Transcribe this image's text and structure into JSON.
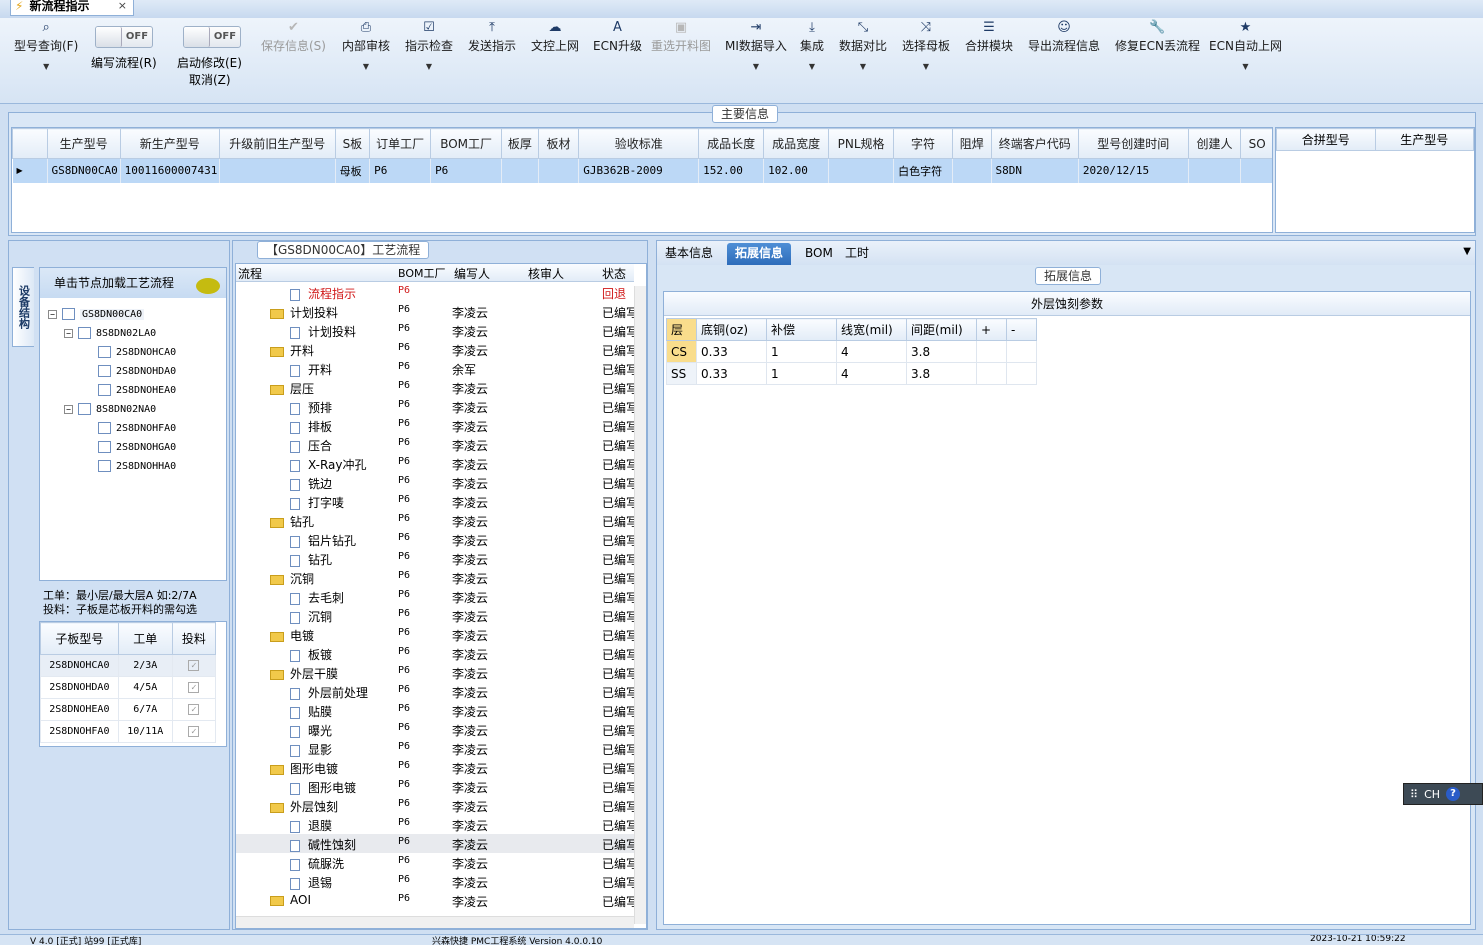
{
  "window_tab": {
    "title": "新流程指示",
    "close": "×"
  },
  "toolbar": {
    "items": [
      {
        "label": "型号查询(F)",
        "icon": "search-icon"
      },
      {
        "label": "保存信息(S)",
        "icon": "check-icon"
      },
      {
        "label": "内部审核",
        "icon": "printer-icon"
      },
      {
        "label": "指示检查",
        "icon": "checkbox-icon"
      },
      {
        "label": "发送指示",
        "icon": "upload-icon"
      },
      {
        "label": "文控上网",
        "icon": "cloud-upload-icon"
      },
      {
        "label": "ECN升级",
        "icon": "font-icon"
      },
      {
        "label": "重选开料图",
        "icon": "image-icon"
      },
      {
        "label": "MI数据导入",
        "icon": "sign-in-icon"
      },
      {
        "label": "集成",
        "icon": "download-icon"
      },
      {
        "label": "数据对比",
        "icon": "compress-icon"
      },
      {
        "label": "选择母板",
        "icon": "shuffle-icon"
      },
      {
        "label": "合拼模块",
        "icon": "list-icon"
      },
      {
        "label": "导出流程信息",
        "icon": "smile-icon"
      },
      {
        "label": "修复ECN丢流程",
        "icon": "wrench-icon"
      },
      {
        "label": "ECN自动上网",
        "icon": "star-icon"
      }
    ],
    "toggle_edit": {
      "state": "OFF",
      "label": "编写流程(R)"
    },
    "toggle_modify": {
      "state": "OFF",
      "label": "启动修改(E)",
      "sublabel": "取消(Z)"
    }
  },
  "main_info": {
    "caption": "主要信息",
    "columns": [
      "生产型号",
      "新生产型号",
      "升级前旧生产型号",
      "S板",
      "订单工厂",
      "BOM工厂",
      "板厚",
      "板材",
      "验收标准",
      "成品长度",
      "成品宽度",
      "PNL规格",
      "字符",
      "阻焊",
      "终端客户代码",
      "型号创建时间",
      "创建人",
      "SO"
    ],
    "row": [
      "GS8DN00CA0",
      "10011600007431",
      "",
      "母板",
      "P6",
      "P6",
      "",
      "",
      "GJB362B-2009",
      "152.00",
      "102.00",
      "",
      "白色字符",
      "",
      "S8DN",
      "2020/12/15",
      "",
      ""
    ],
    "merge_columns": [
      "合拼型号",
      "生产型号"
    ]
  },
  "left": {
    "vertical_tab": "设备结构",
    "hint": "单击节点加载工艺流程",
    "tree": [
      {
        "label": "GS8DN00CA0",
        "level": 0
      },
      {
        "label": "8S8DN02LA0",
        "level": 1
      },
      {
        "label": "2S8DNOHCA0",
        "level": 2
      },
      {
        "label": "2S8DNOHDA0",
        "level": 2
      },
      {
        "label": "2S8DNOHEA0",
        "level": 2
      },
      {
        "label": "8S8DN02NA0",
        "level": 1
      },
      {
        "label": "2S8DNOHFA0",
        "level": 2
      },
      {
        "label": "2S8DNOHGA0",
        "level": 2
      },
      {
        "label": "2S8DNOHHA0",
        "level": 2
      }
    ],
    "note_line1": "工单：最小层/最大层A 如:2/7A",
    "note_line2": "投料：子板是芯板开料的需勾选",
    "sub_columns": [
      "子板型号",
      "工单",
      "投料"
    ],
    "sub_rows": [
      [
        "2S8DNOHCA0",
        "2/3A"
      ],
      [
        "2S8DNOHDA0",
        "4/5A"
      ],
      [
        "2S8DNOHEA0",
        "6/7A"
      ],
      [
        "2S8DNOHFA0",
        "10/11A"
      ]
    ]
  },
  "flow": {
    "caption": "【GS8DN00CA0】工艺流程",
    "columns": [
      "流程",
      "BOM工厂",
      "编写人",
      "核审人",
      "状态"
    ],
    "rows": [
      {
        "name": "流程指示",
        "type": "doc",
        "bom": "P6",
        "author": "",
        "status": "回退",
        "red": true
      },
      {
        "name": "计划投料",
        "type": "folder",
        "bom": "P6",
        "author": "李凌云",
        "status": "已编写"
      },
      {
        "name": "计划投料",
        "type": "doc",
        "bom": "P6",
        "author": "李凌云",
        "status": "已编写"
      },
      {
        "name": "开料",
        "type": "folder",
        "bom": "P6",
        "author": "李凌云",
        "status": "已编写"
      },
      {
        "name": "开料",
        "type": "doc",
        "bom": "P6",
        "author": "余军",
        "status": "已编写"
      },
      {
        "name": "层压",
        "type": "folder",
        "bom": "P6",
        "author": "李凌云",
        "status": "已编写"
      },
      {
        "name": "预排",
        "type": "doc",
        "bom": "P6",
        "author": "李凌云",
        "status": "已编写"
      },
      {
        "name": "排板",
        "type": "doc",
        "bom": "P6",
        "author": "李凌云",
        "status": "已编写"
      },
      {
        "name": "压合",
        "type": "doc",
        "bom": "P6",
        "author": "李凌云",
        "status": "已编写"
      },
      {
        "name": "X-Ray冲孔",
        "type": "doc",
        "bom": "P6",
        "author": "李凌云",
        "status": "已编写"
      },
      {
        "name": "铣边",
        "type": "doc",
        "bom": "P6",
        "author": "李凌云",
        "status": "已编写"
      },
      {
        "name": "打字唛",
        "type": "doc",
        "bom": "P6",
        "author": "李凌云",
        "status": "已编写"
      },
      {
        "name": "钻孔",
        "type": "folder",
        "bom": "P6",
        "author": "李凌云",
        "status": "已编写"
      },
      {
        "name": "铝片钻孔",
        "type": "doc",
        "bom": "P6",
        "author": "李凌云",
        "status": "已编写"
      },
      {
        "name": "钻孔",
        "type": "doc",
        "bom": "P6",
        "author": "李凌云",
        "status": "已编写"
      },
      {
        "name": "沉铜",
        "type": "folder",
        "bom": "P6",
        "author": "李凌云",
        "status": "已编写"
      },
      {
        "name": "去毛刺",
        "type": "doc",
        "bom": "P6",
        "author": "李凌云",
        "status": "已编写"
      },
      {
        "name": "沉铜",
        "type": "doc",
        "bom": "P6",
        "author": "李凌云",
        "status": "已编写"
      },
      {
        "name": "电镀",
        "type": "folder",
        "bom": "P6",
        "author": "李凌云",
        "status": "已编写"
      },
      {
        "name": "板镀",
        "type": "doc",
        "bom": "P6",
        "author": "李凌云",
        "status": "已编写"
      },
      {
        "name": "外层干膜",
        "type": "folder",
        "bom": "P6",
        "author": "李凌云",
        "status": "已编写"
      },
      {
        "name": "外层前处理",
        "type": "doc",
        "bom": "P6",
        "author": "李凌云",
        "status": "已编写"
      },
      {
        "name": "贴膜",
        "type": "doc",
        "bom": "P6",
        "author": "李凌云",
        "status": "已编写"
      },
      {
        "name": "曝光",
        "type": "doc",
        "bom": "P6",
        "author": "李凌云",
        "status": "已编写"
      },
      {
        "name": "显影",
        "type": "doc",
        "bom": "P6",
        "author": "李凌云",
        "status": "已编写"
      },
      {
        "name": "图形电镀",
        "type": "folder",
        "bom": "P6",
        "author": "李凌云",
        "status": "已编写"
      },
      {
        "name": "图形电镀",
        "type": "doc",
        "bom": "P6",
        "author": "李凌云",
        "status": "已编写"
      },
      {
        "name": "外层蚀刻",
        "type": "folder",
        "bom": "P6",
        "author": "李凌云",
        "status": "已编写"
      },
      {
        "name": "退膜",
        "type": "doc",
        "bom": "P6",
        "author": "李凌云",
        "status": "已编写"
      },
      {
        "name": "碱性蚀刻",
        "type": "doc",
        "bom": "P6",
        "author": "李凌云",
        "status": "已编写",
        "selected": true
      },
      {
        "name": "硫脲洗",
        "type": "doc",
        "bom": "P6",
        "author": "李凌云",
        "status": "已编写"
      },
      {
        "name": "退锡",
        "type": "doc",
        "bom": "P6",
        "author": "李凌云",
        "status": "已编写"
      },
      {
        "name": "AOI",
        "type": "folder",
        "bom": "P6",
        "author": "李凌云",
        "status": "已编写"
      }
    ]
  },
  "right": {
    "tabs": [
      "基本信息",
      "拓展信息",
      "BOM",
      "工时"
    ],
    "active_tab": 1,
    "ext_caption": "拓展信息",
    "table_title": "外层蚀刻参数",
    "columns": [
      "层",
      "底铜(oz)",
      "补偿",
      "线宽(mil)",
      "间距(mil)",
      "+",
      "-"
    ],
    "rows": [
      [
        "CS",
        "0.33",
        "1",
        "4",
        "3.8",
        "",
        ""
      ],
      [
        "SS",
        "0.33",
        "1",
        "4",
        "3.8",
        "",
        ""
      ]
    ]
  },
  "ime": {
    "label": "CH",
    "help": "?"
  },
  "status": {
    "left": "V 4.0 [正式] 站99 [正式库]",
    "center": "兴森快捷 PMC工程系统 Version 4.0.0.10",
    "right": "2023-10-21 10:59:22"
  }
}
